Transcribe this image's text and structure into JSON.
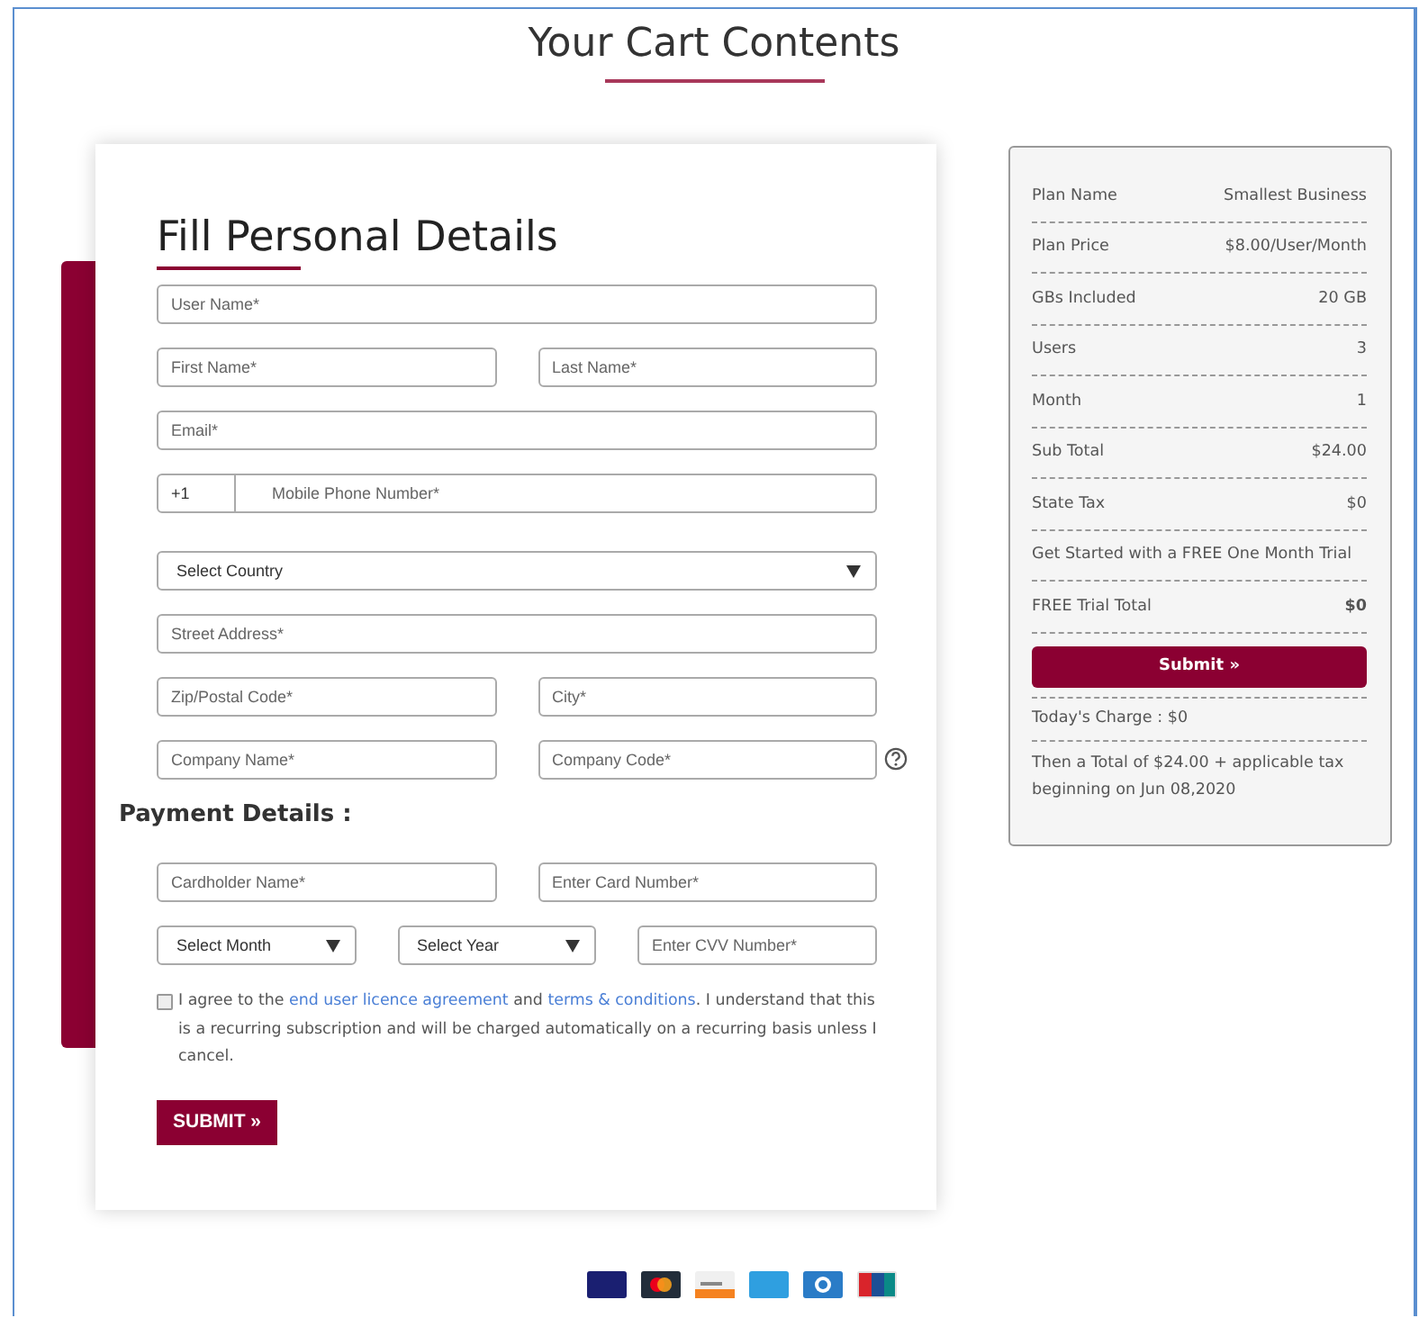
{
  "page_title": "Your Cart Contents",
  "form": {
    "title": "Fill Personal Details",
    "rows": [
      [
        {
          "kind": "input",
          "placeholder": "User Name*"
        }
      ],
      [
        {
          "kind": "input",
          "placeholder": "First Name*"
        },
        {
          "kind": "input",
          "placeholder": "Last Name*"
        }
      ],
      [
        {
          "kind": "input",
          "placeholder": "Email*"
        }
      ],
      [
        {
          "kind": "phone",
          "prefix": "+1",
          "placeholder": "Mobile Phone Number*"
        }
      ],
      [
        {
          "kind": "select",
          "value": "Select Country"
        }
      ],
      [
        {
          "kind": "input",
          "placeholder": "Street Address*"
        }
      ],
      [
        {
          "kind": "input",
          "placeholder": "Zip/Postal Code*"
        },
        {
          "kind": "input",
          "placeholder": "City*"
        }
      ],
      [
        {
          "kind": "input",
          "placeholder": "Company Name*"
        },
        {
          "kind": "input",
          "placeholder": "Company Code*",
          "help": true
        }
      ]
    ],
    "payment_title": "Payment Details :",
    "payment_rows": [
      [
        {
          "kind": "input",
          "placeholder": "Cardholder Name*"
        },
        {
          "kind": "input",
          "placeholder": "Enter Card Number*"
        }
      ],
      [
        {
          "kind": "select",
          "value": "Select Month"
        },
        {
          "kind": "select",
          "value": "Select Year"
        },
        {
          "kind": "input",
          "placeholder": "Enter CVV Number*"
        }
      ]
    ],
    "agreement": {
      "checked": false,
      "parts": [
        {
          "kind": "text",
          "text": "I agree to the "
        },
        {
          "kind": "link",
          "text": "end user licence agreement"
        },
        {
          "kind": "text",
          "text": " and "
        },
        {
          "kind": "link",
          "text": "terms & conditions"
        },
        {
          "kind": "text",
          "text": ". I understand that this is a recurring subscription and will be charged automatically on a recurring basis unless I cancel."
        }
      ]
    },
    "submit": "SUBMIT »"
  },
  "summary": {
    "rows": [
      {
        "label": "Plan Name",
        "value": "Smallest Business"
      },
      {
        "label": "Plan Price",
        "value": "$8.00/User/Month"
      },
      {
        "label": "GBs Included",
        "value": "20 GB"
      },
      {
        "label": "Users",
        "value": "3"
      },
      {
        "label": "Month",
        "value": "1"
      },
      {
        "label": "Sub Total",
        "value": "$24.00"
      },
      {
        "label": "State Tax",
        "value": "$0"
      },
      {
        "label": "Get Started with a FREE One Month Trial"
      },
      {
        "label": "FREE Trial Total",
        "value": "$0",
        "bold": true
      }
    ],
    "submit": "Submit »",
    "today": "Today's Charge : $0",
    "then": "Then a Total of $24.00 + applicable tax beginning on Jun 08,2020"
  },
  "cards": [
    {
      "kind": "visa"
    },
    {
      "kind": "mastercard"
    },
    {
      "kind": "discover"
    },
    {
      "kind": "amex"
    },
    {
      "kind": "diners"
    },
    {
      "kind": "unionpay"
    }
  ]
}
